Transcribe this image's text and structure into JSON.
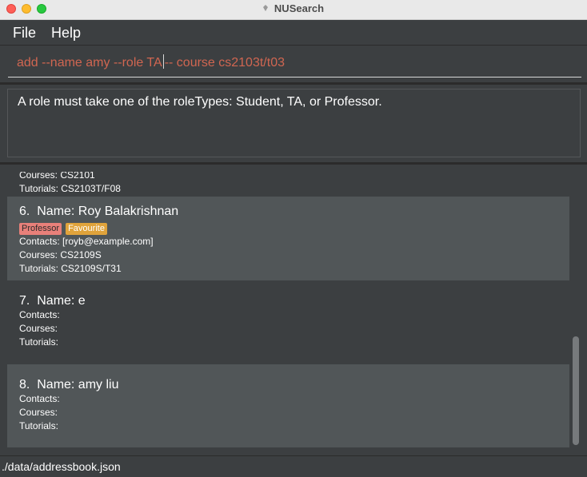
{
  "window": {
    "title": "NUSearch"
  },
  "menu": {
    "file": "File",
    "help": "Help"
  },
  "command": {
    "before_caret": "add --name amy --role TA",
    "after_caret": "-- course cs2103t/t03"
  },
  "result": {
    "message": "A role must take one of the roleTypes: Student, TA, or Professor."
  },
  "persons": [
    {
      "partial_top": "Courses: CS2101",
      "tutorials": "Tutorials: CS2103T/F08"
    },
    {
      "index": "6.",
      "name": "Name: Roy Balakrishnan",
      "tags": [
        {
          "label": "Professor",
          "color": "#e8807a"
        },
        {
          "label": "Favourite",
          "color": "#e0a33b"
        }
      ],
      "contacts": "Contacts: [royb@example.com]",
      "courses": "Courses: CS2109S",
      "tutorials": "Tutorials: CS2109S/T31"
    },
    {
      "index": "7.",
      "name": "Name: e",
      "contacts": "Contacts:",
      "courses": "Courses:",
      "tutorials": "Tutorials:"
    },
    {
      "index": "8.",
      "name": "Name: amy liu",
      "contacts": "Contacts:",
      "courses": "Courses:",
      "tutorials": "Tutorials:"
    }
  ],
  "status": {
    "file_path": "./data/addressbook.json"
  },
  "colors": {
    "background": "#3c3f41",
    "card_alt": "#515658",
    "command_text": "#d06651"
  }
}
